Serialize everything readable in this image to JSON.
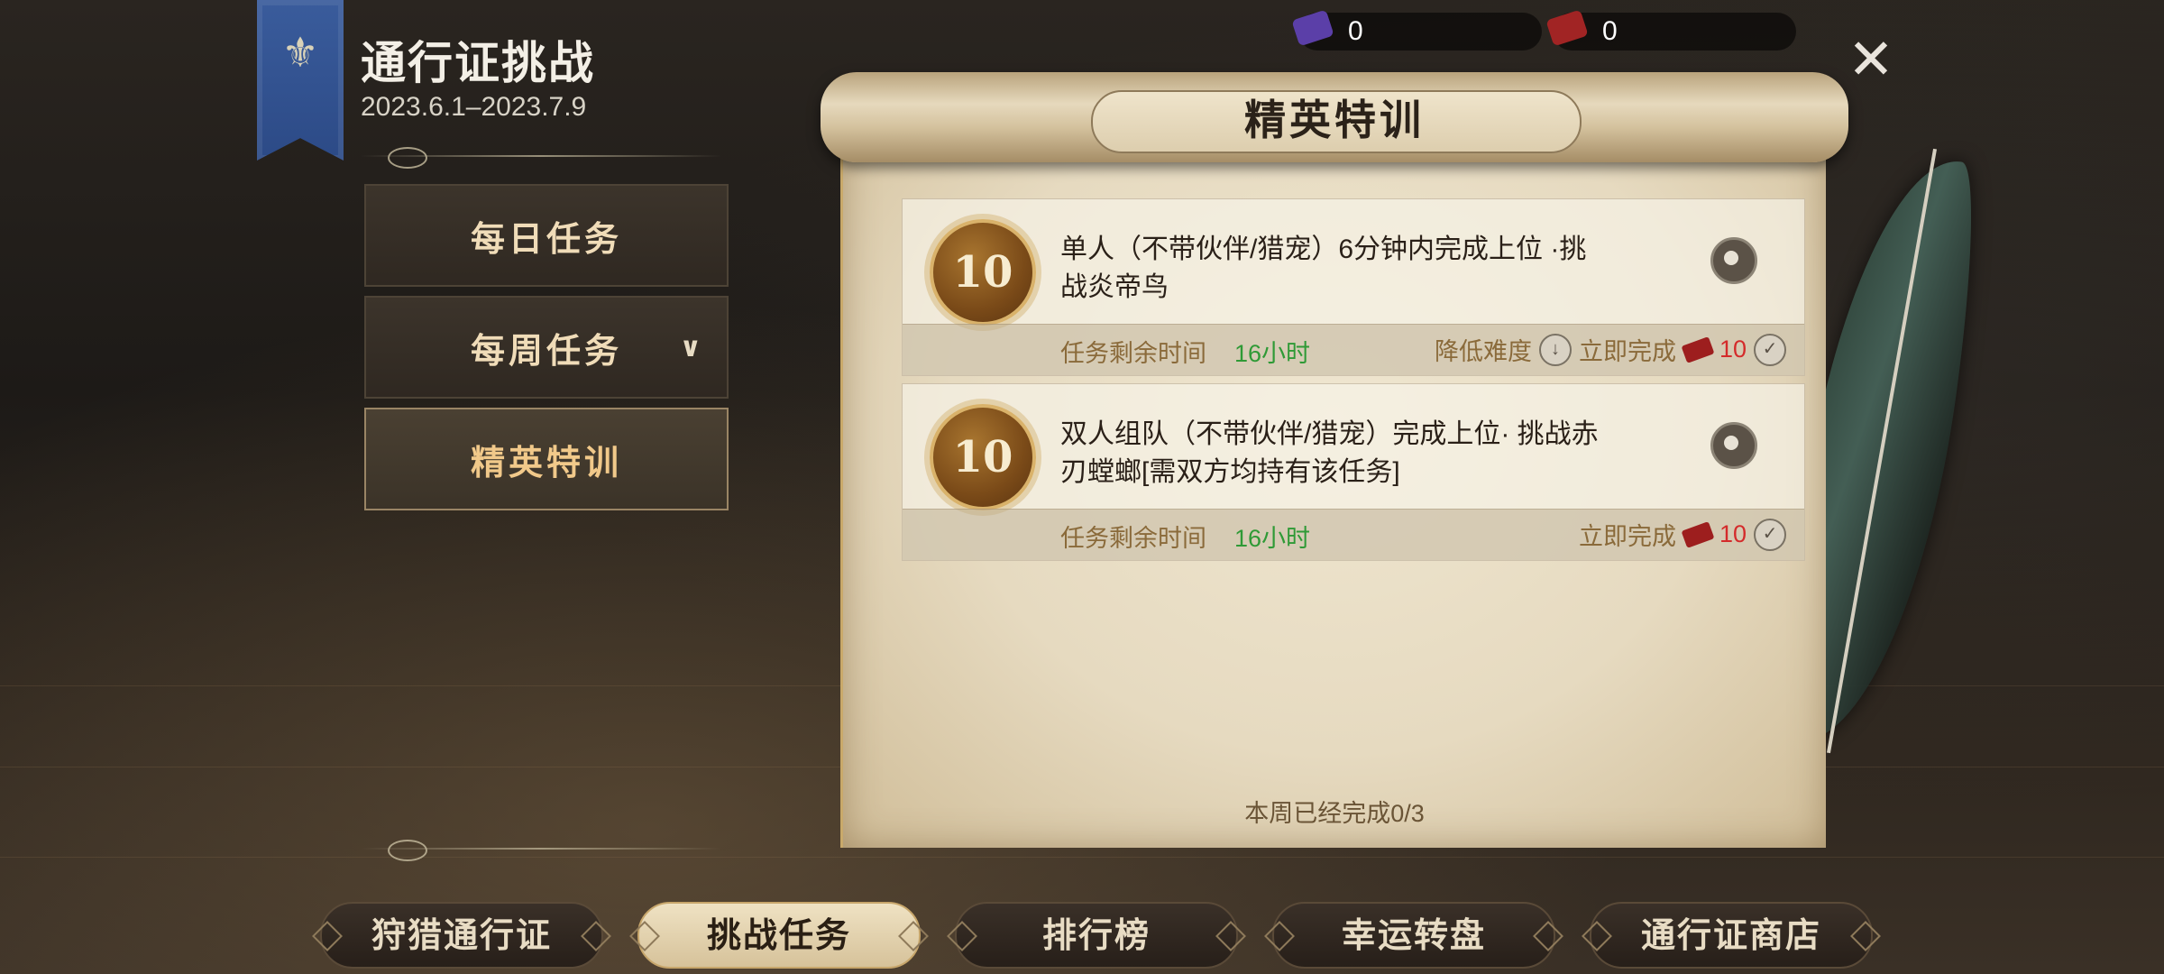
{
  "header": {
    "title": "通行证挑战",
    "date_range": "2023.6.1–2023.7.9"
  },
  "sidebar": {
    "items": [
      {
        "label": "每日任务",
        "active": false
      },
      {
        "label": "每周任务",
        "active": false,
        "has_dropdown": true
      },
      {
        "label": "精英特训",
        "active": true
      }
    ]
  },
  "currency": [
    {
      "icon": "purple-ticket-icon",
      "value": "0",
      "color": "#5b3fa8"
    },
    {
      "icon": "red-ticket-icon",
      "value": "0",
      "color": "#a12424"
    }
  ],
  "panel": {
    "title": "精英特训",
    "weekly_progress": "本周已经完成0/3",
    "tasks": [
      {
        "points": "10",
        "description": "单人（不带伙伴/猎宠）6分钟内完成上位 ·挑战炎帝鸟",
        "time_label": "任务剩余时间",
        "time_value": "16小时",
        "lower_difficulty": "降低难度",
        "complete_now": "立即完成",
        "cost": "10"
      },
      {
        "points": "10",
        "description": "双人组队（不带伙伴/猎宠）完成上位· 挑战赤刃螳螂[需双方均持有该任务]",
        "time_label": "任务剩余时间",
        "time_value": "16小时",
        "complete_now": "立即完成",
        "cost": "10"
      }
    ]
  },
  "tabs": [
    {
      "label": "狩猎通行证",
      "active": false
    },
    {
      "label": "挑战任务",
      "active": true
    },
    {
      "label": "排行榜",
      "active": false
    },
    {
      "label": "幸运转盘",
      "active": false
    },
    {
      "label": "通行证商店",
      "active": false
    }
  ],
  "colors": {
    "accent_gold": "#f1c98a",
    "time_green": "#2f9a36",
    "cost_red": "#d42b2b"
  }
}
